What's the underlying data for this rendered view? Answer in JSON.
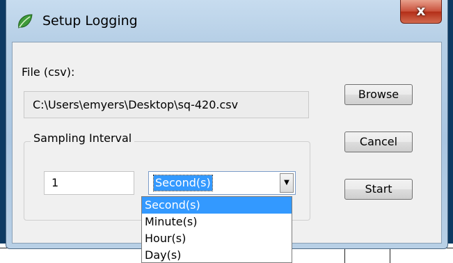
{
  "window": {
    "title": "Setup Logging",
    "close_glyph": "x",
    "app_icon": "green-leaf-icon"
  },
  "form": {
    "file_label": "File (csv):",
    "file_path": "C:\\Users\\emyers\\Desktop\\sq-420.csv",
    "sampling_group_label": "Sampling Interval",
    "interval_value": "1",
    "unit_selected": "Second(s)",
    "unit_options": [
      "Second(s)",
      "Minute(s)",
      "Hour(s)",
      "Day(s)"
    ]
  },
  "buttons": {
    "browse": "Browse",
    "cancel": "Cancel",
    "start": "Start"
  },
  "colors": {
    "selection": "#3399ff",
    "title_bar": "#b6cfe6",
    "close_button": "#c9503a"
  }
}
